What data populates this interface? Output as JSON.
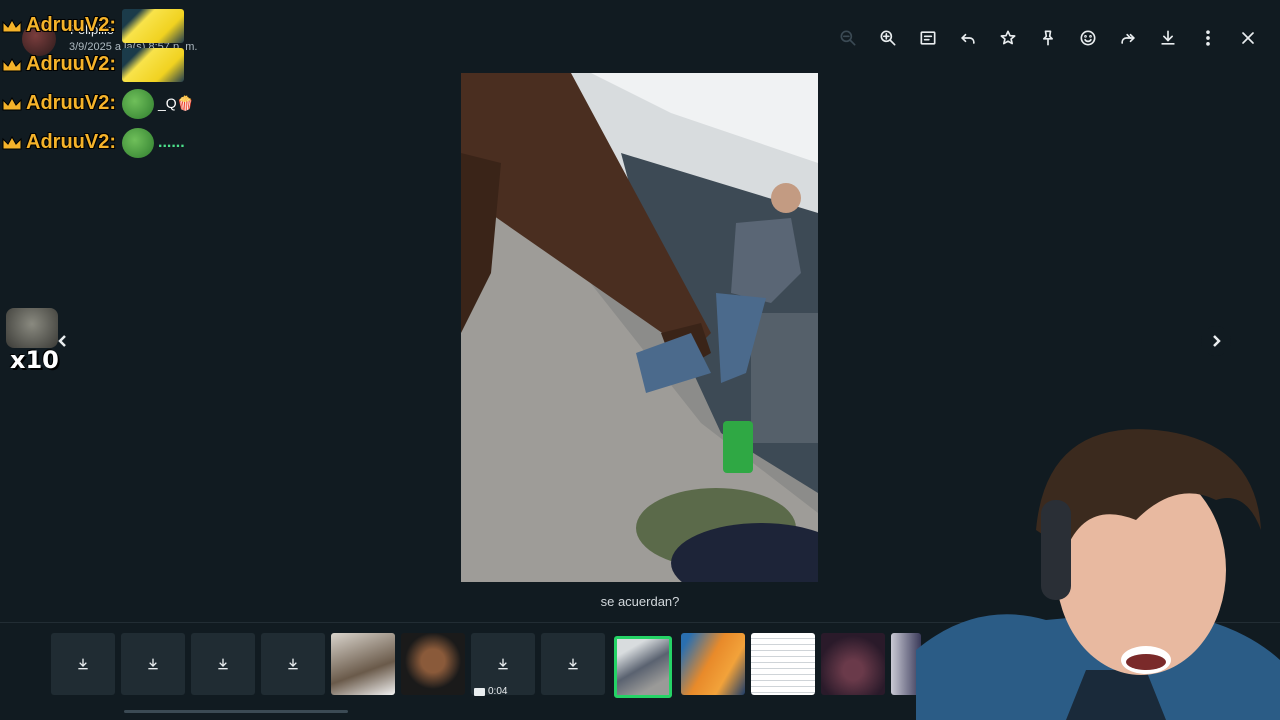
{
  "header": {
    "sender_name": "Felipillo",
    "timestamp": "3/9/2025 a la(s) 8:57 p. m."
  },
  "toolbar": {
    "buttons": [
      "zoom-out",
      "zoom-in",
      "chat-list",
      "reply",
      "star",
      "pin",
      "react",
      "forward",
      "download",
      "more",
      "close"
    ]
  },
  "chat": {
    "lines": [
      {
        "user": "AdruuV2:",
        "emote": "yellow-emote",
        "extra": ""
      },
      {
        "user": "AdruuV2:",
        "emote": "yellow-emote",
        "extra": ""
      },
      {
        "user": "AdruuV2:",
        "emote": "pepe-emote",
        "extra": "_Q🍿"
      },
      {
        "user": "AdruuV2:",
        "emote": "pepe-emote",
        "extra": "......"
      }
    ],
    "sticker_count": "x10"
  },
  "viewer": {
    "caption": "se acuerdan?"
  },
  "thumbnails": {
    "video_duration": "0:04"
  },
  "colors": {
    "background": "#111b21",
    "selected_border": "#25d366",
    "chat_user": "#f5b32a"
  }
}
